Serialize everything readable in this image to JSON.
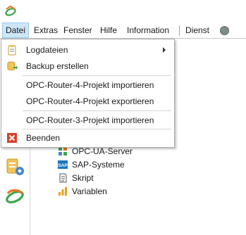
{
  "menubar": {
    "items": [
      "Datei",
      "Extras",
      "Fenster",
      "Hilfe",
      "Information",
      "Dienst"
    ]
  },
  "file_menu": {
    "items": [
      {
        "label": "Logdateien",
        "icon": "logfile-icon",
        "submenu": true
      },
      {
        "label": "Backup erstellen",
        "icon": "backup-icon"
      },
      {
        "label": "OPC-Router-4-Projekt importieren"
      },
      {
        "label": "OPC-Router-4-Projekt exportieren"
      },
      {
        "label": "OPC-Router-3-Projekt importieren"
      },
      {
        "label": "Beenden",
        "icon": "close-icon"
      }
    ]
  },
  "tree": {
    "items": [
      {
        "label": "OPC-UA-Server",
        "icon": "opc-ua-icon"
      },
      {
        "label": "SAP-Systeme",
        "icon": "sap-icon"
      },
      {
        "label": "Skript",
        "icon": "script-icon"
      },
      {
        "label": "Variablen",
        "icon": "variables-icon"
      }
    ]
  },
  "colors": {
    "accent_orange": "#e8781f",
    "accent_green": "#3aa64a",
    "menu_highlight": "#cde6f7",
    "close_red": "#d9412b",
    "status_gray": "#7f8c86"
  }
}
